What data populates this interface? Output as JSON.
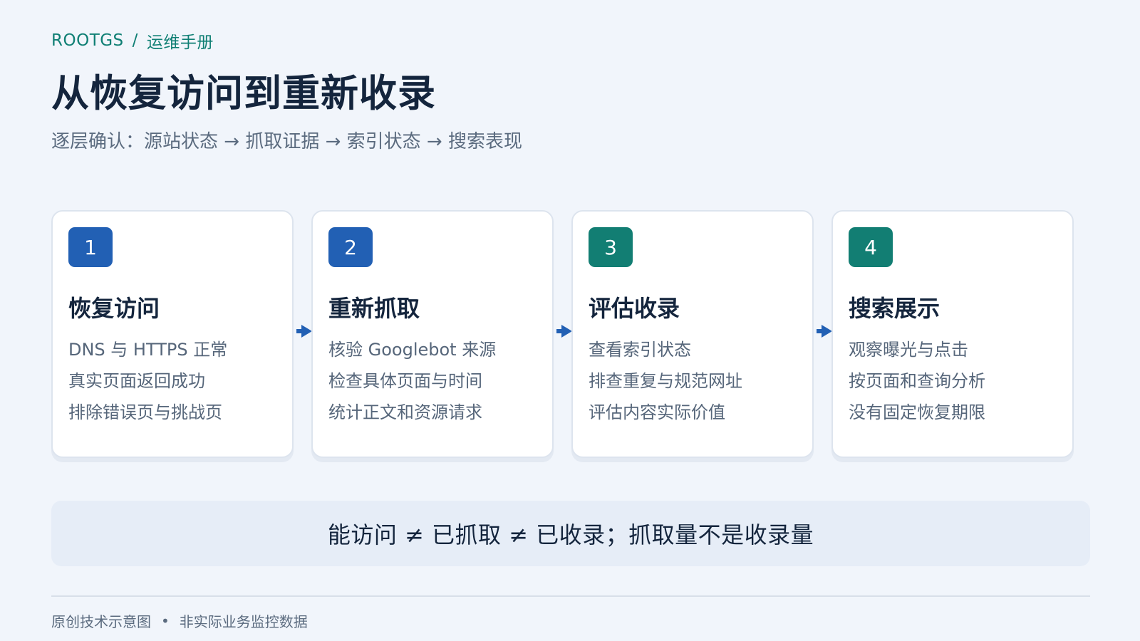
{
  "breadcrumb": {
    "brand": "ROOTGS",
    "separator": "/",
    "section": "运维手册"
  },
  "title": "从恢复访问到重新收录",
  "subtitle": "逐层确认：源站状态 → 抓取证据 → 索引状态 → 搜索表现",
  "steps": [
    {
      "number": "1",
      "title": "恢复访问",
      "lines": [
        "DNS 与 HTTPS 正常",
        "真实页面返回成功",
        "排除错误页与挑战页"
      ],
      "badge_color": "#2260b4"
    },
    {
      "number": "2",
      "title": "重新抓取",
      "lines": [
        "核验 Googlebot 来源",
        "检查具体页面与时间",
        "统计正文和资源请求"
      ],
      "badge_color": "#2260b4"
    },
    {
      "number": "3",
      "title": "评估收录",
      "lines": [
        "查看索引状态",
        "排查重复与规范网址",
        "评估内容实际价值"
      ],
      "badge_color": "#127e73"
    },
    {
      "number": "4",
      "title": "搜索展示",
      "lines": [
        "观察曝光与点击",
        "按页面和查询分析",
        "没有固定恢复期限"
      ],
      "badge_color": "#127e73"
    }
  ],
  "arrow_icon": "arrow-right-icon",
  "arrow_color": "#2260b4",
  "summary": "能访问 ≠ 已抓取 ≠ 已收录；抓取量不是收录量",
  "footer": {
    "left": "原创技术示意图",
    "dot": "•",
    "right": "非实际业务监控数据"
  }
}
